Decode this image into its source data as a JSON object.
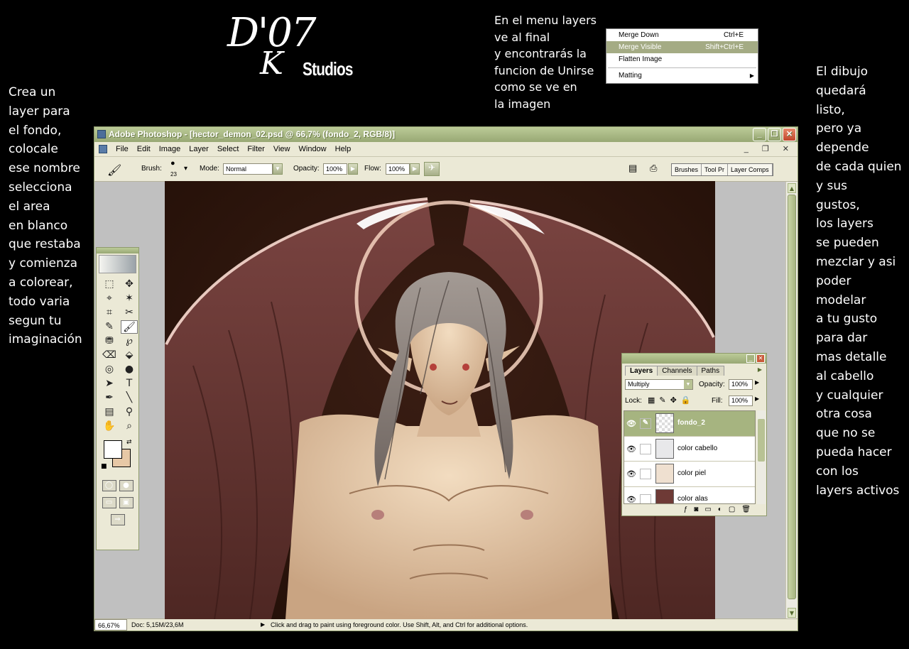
{
  "logo": {
    "big": "D'07",
    "k": "K",
    "studios": "Studios"
  },
  "captions": {
    "left": "Crea un\nlayer para\nel fondo,\ncolocale\nese nombre\nselecciona\nel area\nen blanco\nque restaba\ny comienza\na colorear,\ntodo varia\nsegun tu\nimaginación",
    "top": "En el menu layers\nve al final\ny encontrarás la\nfuncion de Unirse\ncomo se ve en\nla imagen",
    "right": "El dibujo\nquedará\nlisto,\npero ya\ndepende\nde cada quien\ny sus\ngustos,\nlos layers\nse pueden\nmezclar y asi\npoder\nmodelar\na tu gusto\npara dar\nmas detalle\nal cabello\ny cualquier\notra cosa\nque no se\npueda hacer\ncon los\nlayers activos"
  },
  "context_menu": {
    "items": [
      {
        "label": "Merge Down",
        "shortcut": "Ctrl+E"
      },
      {
        "label": "Merge Visible",
        "shortcut": "Shift+Ctrl+E"
      },
      {
        "label": "Flatten Image",
        "shortcut": ""
      },
      {
        "label": "Matting",
        "shortcut": ""
      }
    ],
    "selected": "Merge Visible"
  },
  "window": {
    "title": "Adobe Photoshop - [hector_demon_02.psd @ 66,7% (fondo_2, RGB/8)]",
    "buttons": {
      "minimize": "_",
      "maximize": "❐",
      "close": "✕"
    }
  },
  "menubar": {
    "items": [
      "File",
      "Edit",
      "Image",
      "Layer",
      "Select",
      "Filter",
      "View",
      "Window",
      "Help"
    ],
    "mdi": "_ ❐ ✕"
  },
  "options": {
    "brush_label": "Brush:",
    "brush_size": "23",
    "mode_label": "Mode:",
    "mode_value": "Normal",
    "opacity_label": "Opacity:",
    "opacity_value": "100%",
    "flow_label": "Flow:",
    "flow_value": "100%",
    "palette_tabs": [
      "Brushes",
      "Tool Pr",
      "Layer Comps"
    ]
  },
  "status": {
    "zoom": "66,67%",
    "doc": "Doc: 5,15M/23,6M",
    "hint": "Click and drag to paint using foreground color.  Use Shift, Alt, and Ctrl for additional options."
  },
  "tools": {
    "icons": [
      "⬚",
      "✥",
      "⌖",
      "✶",
      "⌗",
      "✂",
      "✎",
      "🖌",
      "⛃",
      "℘",
      "⌫",
      "⬙",
      "◎",
      "●",
      "➤",
      "T",
      "✒",
      "╲",
      "▤",
      "⚲",
      "✋",
      "⌕"
    ],
    "foreground": "#ffffff",
    "background": "#e7c8a6"
  },
  "layers_panel": {
    "tabs": [
      "Layers",
      "Channels",
      "Paths"
    ],
    "active_tab": "Layers",
    "blend_mode": "Multiply",
    "opacity_label": "Opacity:",
    "opacity_value": "100%",
    "lock_label": "Lock:",
    "fill_label": "Fill:",
    "fill_value": "100%",
    "layers": [
      {
        "name": "fondo_2",
        "selected": true
      },
      {
        "name": "color cabello",
        "selected": false
      },
      {
        "name": "color piel",
        "selected": false
      },
      {
        "name": "color alas",
        "selected": false
      }
    ]
  },
  "colors": {
    "accent": "#a6b480",
    "titlebar": "#98a874",
    "canvas_bg": "#c0c0c0",
    "skin": "#e7c8a6",
    "wings": "#6e3a36"
  }
}
